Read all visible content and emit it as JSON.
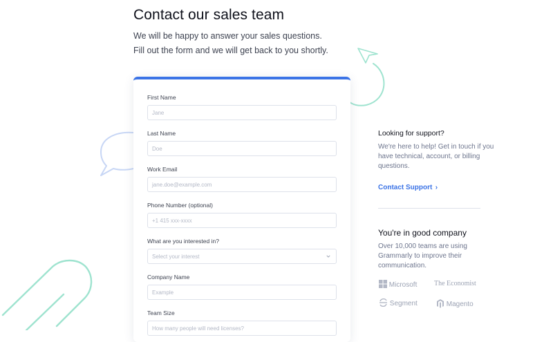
{
  "header": {
    "title": "Contact our sales team",
    "subtitle_line1": "We will be happy to answer your sales questions.",
    "subtitle_line2": "Fill out the form and we will get back to you shortly."
  },
  "form": {
    "accent_color": "#3b73e6",
    "fields": [
      {
        "label": "First Name",
        "placeholder": "Jane"
      },
      {
        "label": "Last Name",
        "placeholder": "Doe"
      },
      {
        "label": "Work Email",
        "placeholder": "jane.doe@example.com"
      },
      {
        "label": "Phone Number (optional)",
        "placeholder": "+1 415 xxx-xxxx"
      },
      {
        "label": "What are you interested in?",
        "placeholder": "Select your interest"
      },
      {
        "label": "Company Name",
        "placeholder": "Example"
      },
      {
        "label": "Team Size",
        "placeholder": "How many people will need licenses?"
      }
    ]
  },
  "support": {
    "heading": "Looking for support?",
    "text": "We're here to help! Get in touch if you have technical, account, or billing questions.",
    "link_label": "Contact Support",
    "link_arrow": "›"
  },
  "company": {
    "heading": "You're in good company",
    "text": "Over 10,000 teams are using Grammarly to improve their communication.",
    "logos": [
      "Microsoft",
      "The Economist",
      "Segment",
      "Magento"
    ]
  },
  "icons": [
    "paper-plane-icon",
    "speech-bubble-icon",
    "paperclip-icon",
    "chevron-down-icon"
  ]
}
